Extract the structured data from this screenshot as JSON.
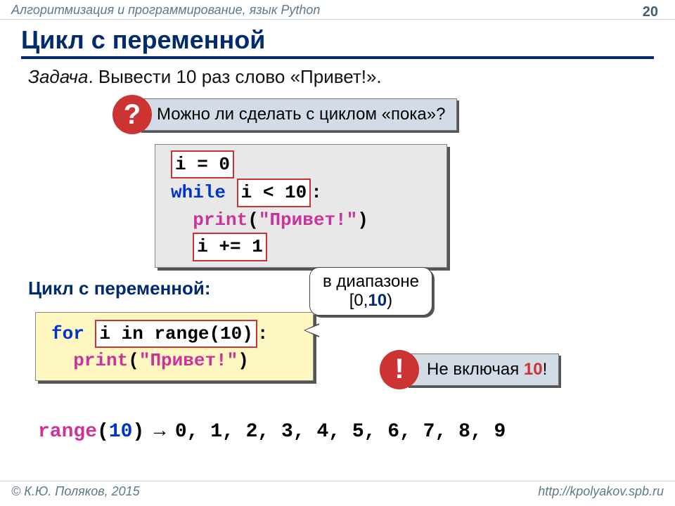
{
  "header": {
    "course": "Алгоритмизация и программирование, язык Python",
    "page": "20"
  },
  "title": "Цикл с переменной",
  "task": {
    "label": "Задача",
    "text": ". Вывести 10 раз слово «Привет!»."
  },
  "question": {
    "mark": "?",
    "text": "Можно ли сделать с циклом «пока»?"
  },
  "code_while": {
    "l1_box": "i = 0",
    "l2_kw": "while",
    "l2_box": "i < 10",
    "l2_colon": ":",
    "l3_fn": "print",
    "l3_open": "(",
    "l3_str": "\"Привет!\"",
    "l3_close": ")",
    "l4_box": "i += 1"
  },
  "subhead": "Цикл с переменной:",
  "code_for": {
    "kw_for": "for",
    "box": "i in range(10)",
    "colon": ":",
    "fn": "print",
    "open": "(",
    "str": "\"Привет!\"",
    "close": ")"
  },
  "bubble": {
    "line1": "в диапазоне",
    "line2a": "[0,",
    "line2b": "10",
    "line2c": ")"
  },
  "exclaim": {
    "mark": "!",
    "text_a": "Не включая ",
    "text_b": "10",
    "text_c": "!"
  },
  "rangeline": {
    "fn": "range",
    "open": "(",
    "arg": "10",
    "close": ")",
    "arrow": " → ",
    "seq": "0, 1, 2, 3, 4, 5, 6, 7, 8, 9"
  },
  "footer": {
    "left": "© К.Ю. Поляков, 2015",
    "right": "http://kpolyakov.spb.ru"
  }
}
